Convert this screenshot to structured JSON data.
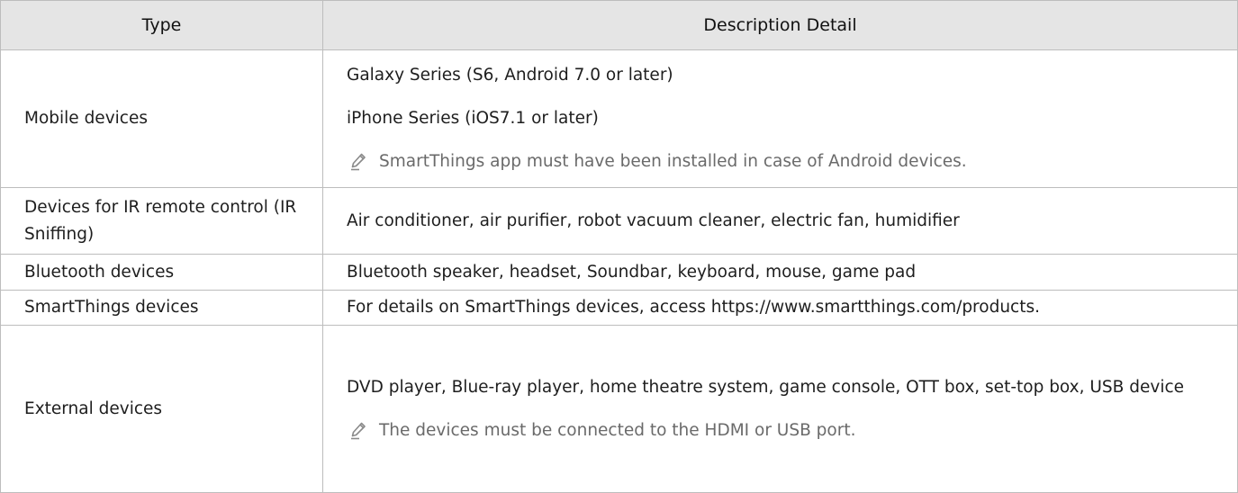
{
  "header": {
    "type": "Type",
    "description": "Description Detail"
  },
  "rows": [
    {
      "type": "Mobile devices",
      "lines": [
        "Galaxy Series (S6, Android 7.0 or later)",
        "iPhone Series (iOS7.1 or later)"
      ],
      "note": "SmartThings app must have been installed in case of Android devices."
    },
    {
      "type": "Devices for IR remote control (IR Sniffing)",
      "lines": [
        "Air conditioner, air purifier, robot vacuum cleaner, electric fan, humidifier"
      ]
    },
    {
      "type": "Bluetooth devices",
      "lines": [
        "Bluetooth speaker, headset, Soundbar, keyboard, mouse, game pad"
      ]
    },
    {
      "type": "SmartThings devices",
      "lines": [
        "For details on SmartThings devices, access https://www.smartthings.com/products."
      ]
    },
    {
      "type": "External devices",
      "lines": [
        "DVD player, Blue-ray player, home theatre system, game console, OTT box, set-top box, USB device"
      ],
      "note": "The devices must be connected to the HDMI or USB port."
    }
  ],
  "icons": {
    "note": "pencil-note-icon"
  },
  "colors": {
    "header_bg": "#e5e5e5",
    "border": "#bdbdbd",
    "note_text": "#6a6a6a"
  }
}
